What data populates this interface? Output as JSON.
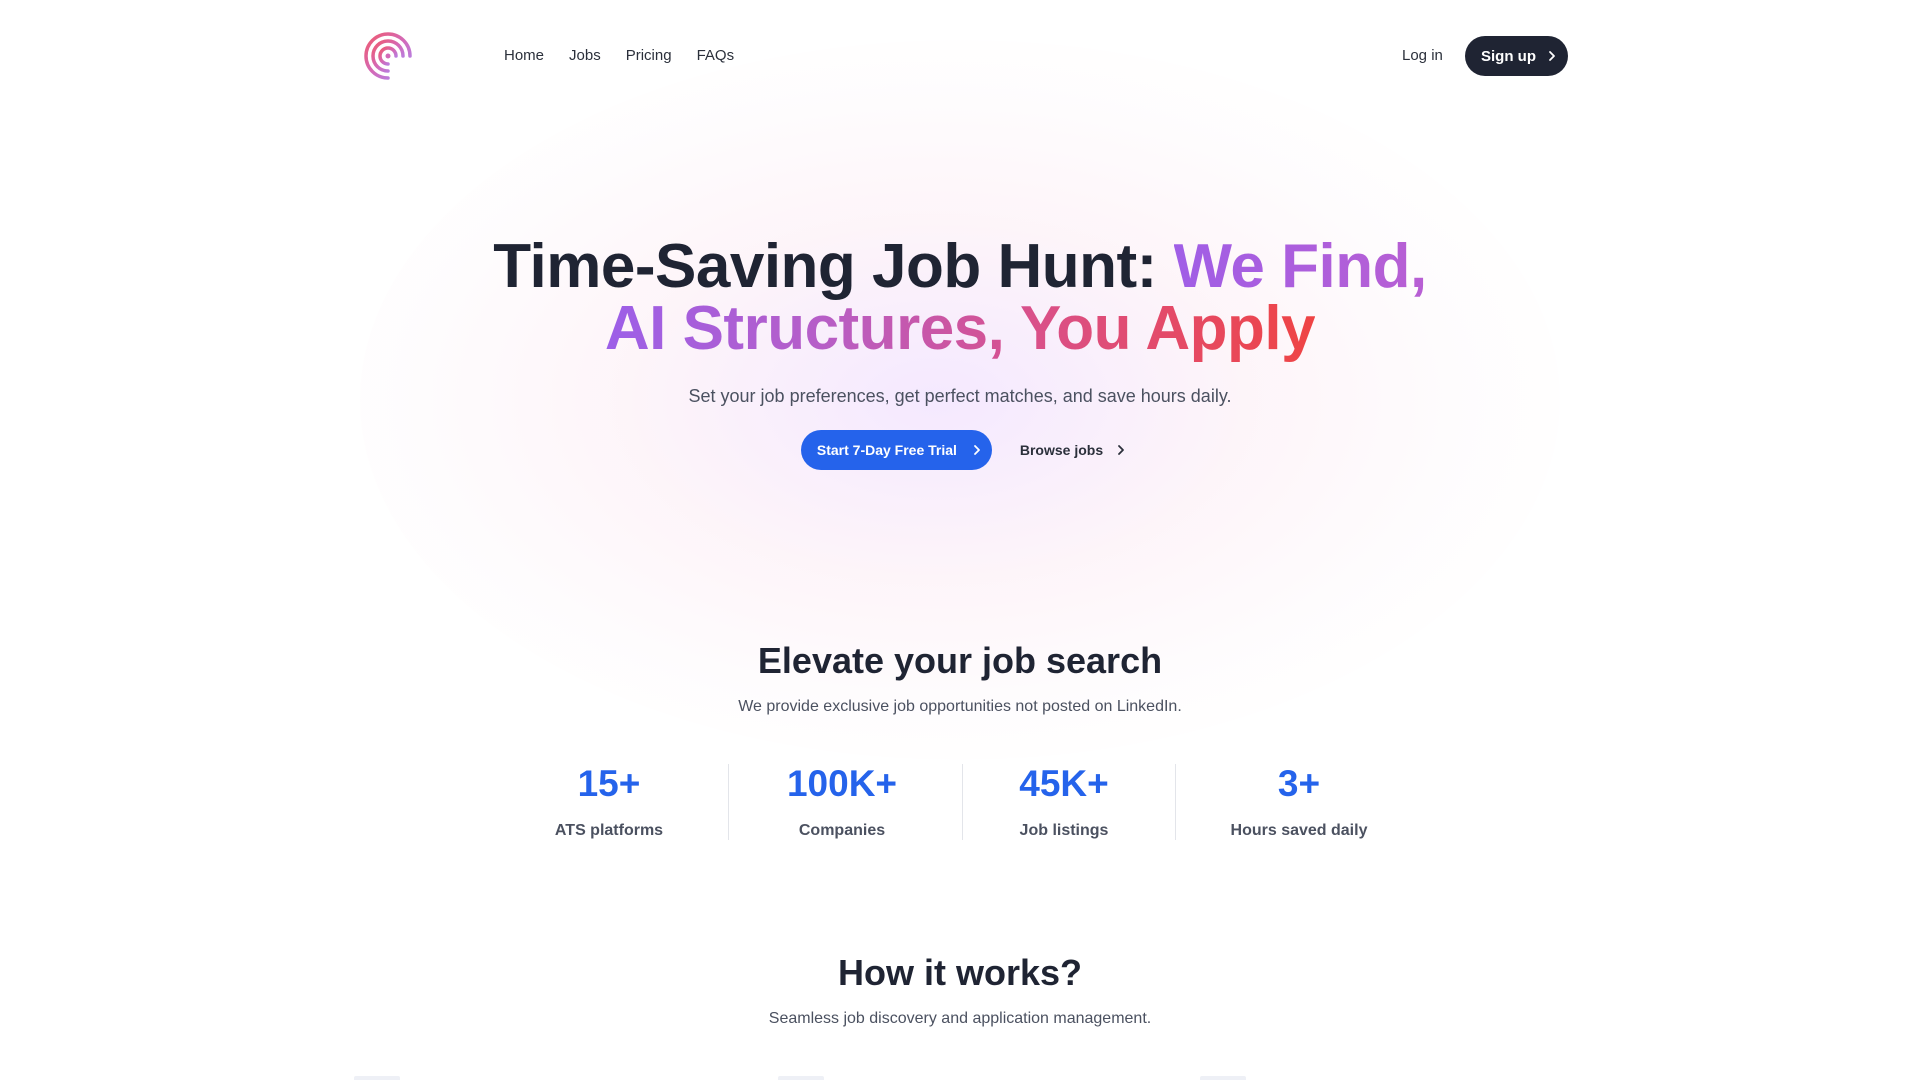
{
  "nav": {
    "logo_icon": "spiral-logo-icon",
    "links": [
      {
        "label": "Home"
      },
      {
        "label": "Jobs"
      },
      {
        "label": "Pricing"
      },
      {
        "label": "FAQs"
      }
    ],
    "login_label": "Log in",
    "signup_label": "Sign up"
  },
  "hero": {
    "title_part1": "Time-Saving Job Hunt: ",
    "title_part2": "We Find,",
    "title_part3": "AI Structures, You Apply",
    "subtitle": "Set your job preferences, get perfect matches, and save hours daily.",
    "primary_cta": "Start 7-Day Free Trial",
    "secondary_cta": "Browse jobs"
  },
  "elevate": {
    "title": "Elevate your job search",
    "subtitle": "We provide exclusive job opportunities not posted on LinkedIn.",
    "stats": [
      {
        "value": "15+",
        "label": "ATS platforms"
      },
      {
        "value": "100K+",
        "label": "Companies"
      },
      {
        "value": "45K+",
        "label": "Job listings"
      },
      {
        "value": "3+",
        "label": "Hours saved daily"
      }
    ]
  },
  "how": {
    "title": "How it works?",
    "subtitle": "Seamless job discovery and application management."
  },
  "colors": {
    "primary": "#2563eb",
    "dark": "#1f2433",
    "gradient_start": "#9c5fe8",
    "gradient_end": "#ef4444"
  }
}
